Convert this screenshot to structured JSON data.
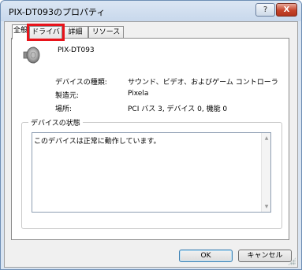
{
  "window": {
    "title": "PIX-DT093のプロパティ",
    "help_label": "?",
    "close_label": "X"
  },
  "tabs": [
    {
      "label": "全般",
      "active": true
    },
    {
      "label": "ドライバ",
      "active": false,
      "highlighted": true
    },
    {
      "label": "詳細",
      "active": false
    },
    {
      "label": "リソース",
      "active": false
    }
  ],
  "device": {
    "name": "PIX-DT093",
    "icon": "speaker-icon"
  },
  "properties": [
    {
      "label": "デバイスの種類:",
      "value": "サウンド、ビデオ、およびゲーム コントローラ"
    },
    {
      "label": "製造元:",
      "value": "Pixela"
    },
    {
      "label": "場所:",
      "value": "PCI バス 3, デバイス 0, 機能 0"
    }
  ],
  "status": {
    "legend": "デバイスの状態",
    "text": "このデバイスは正常に動作しています。"
  },
  "buttons": {
    "ok": "OK",
    "cancel": "キャンセル"
  },
  "colors": {
    "highlight": "#e8141b",
    "title_bg": "#d9e4f1"
  }
}
